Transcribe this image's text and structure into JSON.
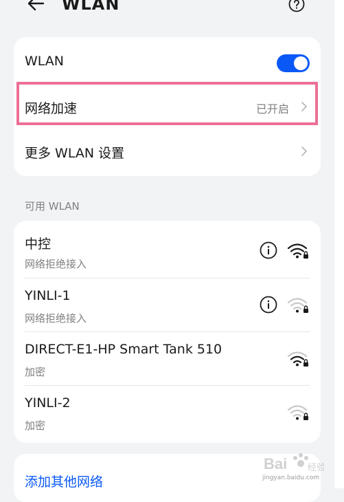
{
  "header": {
    "title": "WLAN",
    "back_icon": "back-arrow-icon",
    "help_icon": "help-icon"
  },
  "settings": {
    "wlan_label": "WLAN",
    "wlan_enabled": true,
    "accel_label": "网络加速",
    "accel_value": "已开启",
    "more_label": "更多 WLAN 设置"
  },
  "available": {
    "section_label": "可用 WLAN",
    "networks": [
      {
        "name": "中控",
        "status": "网络拒绝接入",
        "has_info": true,
        "signal": "strong-locked"
      },
      {
        "name": "YINLI-1",
        "status": "网络拒绝接入",
        "has_info": true,
        "signal": "weak-locked"
      },
      {
        "name": "DIRECT-E1-HP Smart Tank 510",
        "status": "加密",
        "has_info": false,
        "signal": "medium-locked"
      },
      {
        "name": "YINLI-2",
        "status": "加密",
        "has_info": false,
        "signal": "weak-locked"
      }
    ]
  },
  "add_network": {
    "label": "添加其他网络"
  },
  "watermark": {
    "text": "jingyan.baidu.com"
  },
  "colors": {
    "accent": "#0a59f7",
    "highlight": "#ec6f95",
    "background": "#f1f3f5"
  }
}
